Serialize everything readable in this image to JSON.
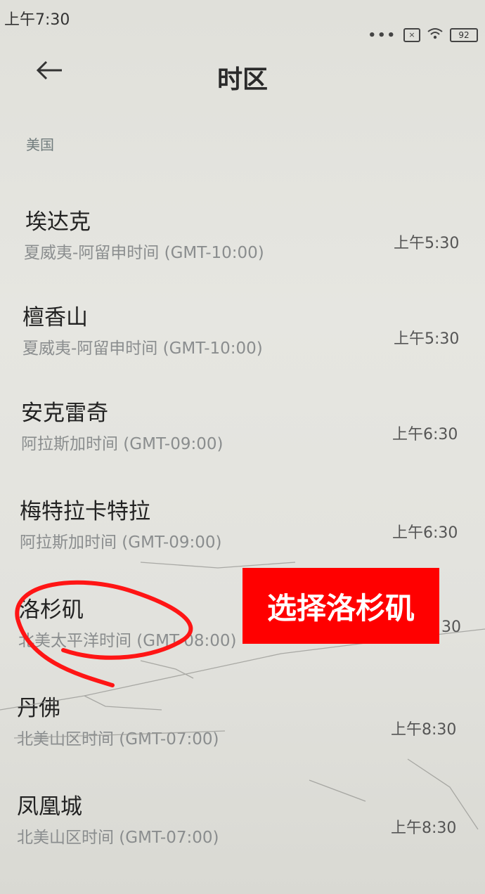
{
  "status_bar": {
    "time": "上午7:30",
    "battery": "92"
  },
  "header": {
    "title": "时区"
  },
  "section": {
    "label": "美国"
  },
  "timezones": [
    {
      "city": "埃达克",
      "zone": "夏威夷-阿留申时间 (GMT-10:00)",
      "time": "上午5:30"
    },
    {
      "city": "檀香山",
      "zone": "夏威夷-阿留申时间 (GMT-10:00)",
      "time": "上午5:30"
    },
    {
      "city": "安克雷奇",
      "zone": "阿拉斯加时间 (GMT-09:00)",
      "time": "上午6:30"
    },
    {
      "city": "梅特拉卡特拉",
      "zone": "阿拉斯加时间 (GMT-09:00)",
      "time": "上午6:30"
    },
    {
      "city": "洛杉矶",
      "zone": "北美太平洋时间 (GMT-08:00)",
      "time": "30"
    },
    {
      "city": "丹佛",
      "zone": "北美山区时间 (GMT-07:00)",
      "time": "上午8:30"
    },
    {
      "city": "凤凰城",
      "zone": "北美山区时间 (GMT-07:00)",
      "time": "上午8:30"
    }
  ],
  "annotation": {
    "callout_text": "选择洛杉矶",
    "callout_color": "#ff0000"
  }
}
